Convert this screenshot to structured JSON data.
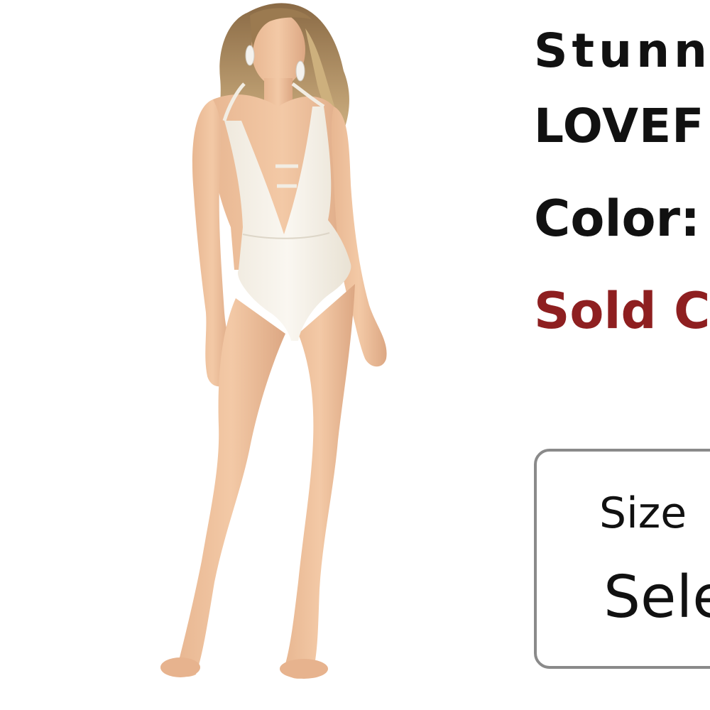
{
  "product": {
    "image_alt": "model wearing white plunge one-piece swimsuit",
    "title_line1": "Stunn",
    "title_line2": "LOVEF",
    "color_label": "Color:",
    "stock_status": "Sold C",
    "size_selector": {
      "label": "Size",
      "value": "Sele"
    }
  },
  "colors": {
    "sold_out": "#8e1f20",
    "text": "#111111",
    "border": "#8a8a8a"
  }
}
